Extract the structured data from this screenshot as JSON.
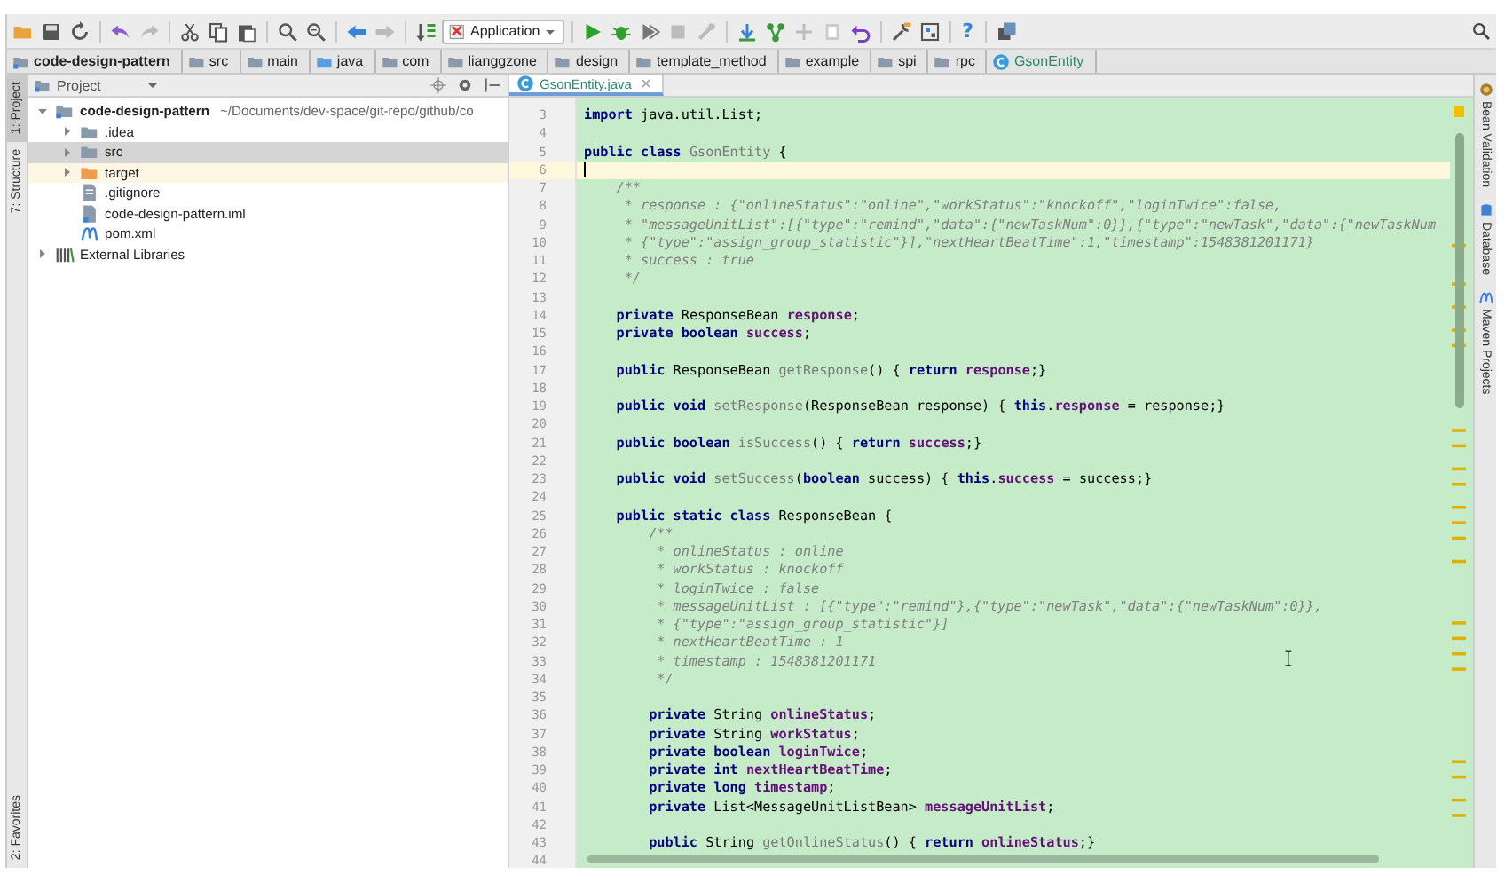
{
  "toolbar": {
    "run_configuration": "Application",
    "help": "?"
  },
  "breadcrumbs": [
    {
      "label": "code-design-pattern",
      "kind": "project"
    },
    {
      "label": "src",
      "kind": "folder"
    },
    {
      "label": "main",
      "kind": "folder"
    },
    {
      "label": "java",
      "kind": "source"
    },
    {
      "label": "com",
      "kind": "folder"
    },
    {
      "label": "lianggzone",
      "kind": "folder"
    },
    {
      "label": "design",
      "kind": "folder"
    },
    {
      "label": "template_method",
      "kind": "folder"
    },
    {
      "label": "example",
      "kind": "folder"
    },
    {
      "label": "spi",
      "kind": "folder"
    },
    {
      "label": "rpc",
      "kind": "folder"
    },
    {
      "label": "GsonEntity",
      "kind": "class"
    }
  ],
  "left_stripe": [
    {
      "label": "1: Project",
      "selected": true
    },
    {
      "label": "7: Structure",
      "selected": false
    }
  ],
  "left_stripe_bottom": [
    {
      "label": "2: Favorites",
      "selected": false
    }
  ],
  "right_stripe": [
    {
      "label": "Bean Validation",
      "kind": "bean"
    },
    {
      "label": "Database",
      "kind": "database"
    },
    {
      "label": "Maven Projects",
      "kind": "maven"
    }
  ],
  "project_panel": {
    "title": "Project",
    "tree": [
      {
        "label": "code-design-pattern",
        "detail": "~/Documents/dev-space/git-repo/github/co",
        "kind": "project",
        "expanded": true,
        "selected": false,
        "highlighted": false,
        "children": [
          {
            "label": ".idea",
            "kind": "folder",
            "expanded": false,
            "selected": false,
            "highlighted": false
          },
          {
            "label": "src",
            "kind": "folder",
            "expanded": false,
            "selected": true,
            "highlighted": false
          },
          {
            "label": "target",
            "kind": "excluded",
            "expanded": false,
            "selected": false,
            "highlighted": true
          },
          {
            "label": ".gitignore",
            "kind": "file",
            "selected": false,
            "highlighted": false
          },
          {
            "label": "code-design-pattern.iml",
            "kind": "module",
            "selected": false,
            "highlighted": false
          },
          {
            "label": "pom.xml",
            "kind": "maven",
            "selected": false,
            "highlighted": false
          }
        ]
      },
      {
        "label": "External Libraries",
        "kind": "library",
        "expanded": false,
        "selected": false,
        "highlighted": false
      }
    ]
  },
  "editor": {
    "tabs": [
      {
        "label": "GsonEntity.java",
        "selected": true
      }
    ],
    "lines": [
      {
        "number": "3",
        "current": false,
        "tokens": [
          {
            "kind": "keyword",
            "text": "import"
          },
          {
            "kind": "plain",
            "text": " java.util.List;"
          }
        ]
      },
      {
        "number": "4",
        "current": false
      },
      {
        "number": "5",
        "current": false,
        "tokens": [
          {
            "kind": "keyword",
            "text": "public class "
          },
          {
            "kind": "unused",
            "text": "GsonEntity"
          },
          {
            "kind": "plain",
            "text": " {"
          }
        ]
      },
      {
        "number": "6",
        "current": true
      },
      {
        "number": "7",
        "current": false,
        "tokens": [
          {
            "kind": "comment",
            "text": "    /**"
          }
        ]
      },
      {
        "number": "8",
        "current": false,
        "tokens": [
          {
            "kind": "comment",
            "text": "     * response : {\"onlineStatus\":\"online\",\"workStatus\":\"knockoff\",\"loginTwice\":false,"
          }
        ]
      },
      {
        "number": "9",
        "current": false,
        "tokens": [
          {
            "kind": "comment",
            "text": "     * \"messageUnitList\":[{\"type\":\"remind\",\"data\":{\"newTaskNum\":0}},{\"type\":\"newTask\",\"data\":{\"newTaskNum"
          }
        ]
      },
      {
        "number": "10",
        "current": false,
        "tokens": [
          {
            "kind": "comment",
            "text": "     * {\"type\":\"assign_group_statistic\"}],\"nextHeartBeatTime\":1,\"timestamp\":1548381201171}"
          }
        ]
      },
      {
        "number": "11",
        "current": false,
        "tokens": [
          {
            "kind": "comment",
            "text": "     * success : true"
          }
        ]
      },
      {
        "number": "12",
        "current": false,
        "tokens": [
          {
            "kind": "comment",
            "text": "     */"
          }
        ]
      },
      {
        "number": "13",
        "current": false
      },
      {
        "number": "14",
        "current": false,
        "tokens": [
          {
            "kind": "keyword",
            "text": "    private"
          },
          {
            "kind": "plain",
            "text": " ResponseBean "
          },
          {
            "kind": "field",
            "text": "response"
          },
          {
            "kind": "plain",
            "text": ";"
          }
        ]
      },
      {
        "number": "15",
        "current": false,
        "tokens": [
          {
            "kind": "keyword",
            "text": "    private boolean "
          },
          {
            "kind": "field",
            "text": "success"
          },
          {
            "kind": "plain",
            "text": ";"
          }
        ]
      },
      {
        "number": "16",
        "current": false
      },
      {
        "number": "17",
        "current": false,
        "tokens": [
          {
            "kind": "keyword",
            "text": "    public"
          },
          {
            "kind": "plain",
            "text": " ResponseBean "
          },
          {
            "kind": "unused",
            "text": "getResponse"
          },
          {
            "kind": "plain",
            "text": "() { "
          },
          {
            "kind": "keyword",
            "text": "return "
          },
          {
            "kind": "field",
            "text": "response"
          },
          {
            "kind": "plain",
            "text": ";}"
          }
        ]
      },
      {
        "number": "18",
        "current": false
      },
      {
        "number": "19",
        "current": false,
        "tokens": [
          {
            "kind": "keyword",
            "text": "    public void "
          },
          {
            "kind": "unused",
            "text": "setResponse"
          },
          {
            "kind": "plain",
            "text": "(ResponseBean response) { "
          },
          {
            "kind": "keyword",
            "text": "this"
          },
          {
            "kind": "plain",
            "text": "."
          },
          {
            "kind": "field",
            "text": "response"
          },
          {
            "kind": "plain",
            "text": " = response;}"
          }
        ]
      },
      {
        "number": "20",
        "current": false
      },
      {
        "number": "21",
        "current": false,
        "tokens": [
          {
            "kind": "keyword",
            "text": "    public boolean "
          },
          {
            "kind": "unused",
            "text": "isSuccess"
          },
          {
            "kind": "plain",
            "text": "() { "
          },
          {
            "kind": "keyword",
            "text": "return "
          },
          {
            "kind": "field",
            "text": "success"
          },
          {
            "kind": "plain",
            "text": ";}"
          }
        ]
      },
      {
        "number": "22",
        "current": false
      },
      {
        "number": "23",
        "current": false,
        "tokens": [
          {
            "kind": "keyword",
            "text": "    public void "
          },
          {
            "kind": "unused",
            "text": "setSuccess"
          },
          {
            "kind": "plain",
            "text": "("
          },
          {
            "kind": "keyword",
            "text": "boolean"
          },
          {
            "kind": "plain",
            "text": " success) { "
          },
          {
            "kind": "keyword",
            "text": "this"
          },
          {
            "kind": "plain",
            "text": "."
          },
          {
            "kind": "field",
            "text": "success"
          },
          {
            "kind": "plain",
            "text": " = success;}"
          }
        ]
      },
      {
        "number": "24",
        "current": false
      },
      {
        "number": "25",
        "current": false,
        "tokens": [
          {
            "kind": "keyword",
            "text": "    public static class"
          },
          {
            "kind": "plain",
            "text": " ResponseBean {"
          }
        ]
      },
      {
        "number": "26",
        "current": false,
        "tokens": [
          {
            "kind": "comment",
            "text": "        /**"
          }
        ]
      },
      {
        "number": "27",
        "current": false,
        "tokens": [
          {
            "kind": "comment",
            "text": "         * onlineStatus : online"
          }
        ]
      },
      {
        "number": "28",
        "current": false,
        "tokens": [
          {
            "kind": "comment",
            "text": "         * workStatus : knockoff"
          }
        ]
      },
      {
        "number": "29",
        "current": false,
        "tokens": [
          {
            "kind": "comment",
            "text": "         * loginTwice : false"
          }
        ]
      },
      {
        "number": "30",
        "current": false,
        "tokens": [
          {
            "kind": "comment",
            "text": "         * messageUnitList : [{\"type\":\"remind\"},{\"type\":\"newTask\",\"data\":{\"newTaskNum\":0}},"
          }
        ]
      },
      {
        "number": "31",
        "current": false,
        "tokens": [
          {
            "kind": "comment",
            "text": "         * {\"type\":\"assign_group_statistic\"}]"
          }
        ]
      },
      {
        "number": "32",
        "current": false,
        "tokens": [
          {
            "kind": "comment",
            "text": "         * nextHeartBeatTime : 1"
          }
        ]
      },
      {
        "number": "33",
        "current": false,
        "tokens": [
          {
            "kind": "comment",
            "text": "         * timestamp : 1548381201171"
          }
        ]
      },
      {
        "number": "34",
        "current": false,
        "tokens": [
          {
            "kind": "comment",
            "text": "         */"
          }
        ]
      },
      {
        "number": "35",
        "current": false
      },
      {
        "number": "36",
        "current": false,
        "tokens": [
          {
            "kind": "keyword",
            "text": "        private"
          },
          {
            "kind": "plain",
            "text": " String "
          },
          {
            "kind": "field",
            "text": "onlineStatus"
          },
          {
            "kind": "plain",
            "text": ";"
          }
        ]
      },
      {
        "number": "37",
        "current": false,
        "tokens": [
          {
            "kind": "keyword",
            "text": "        private"
          },
          {
            "kind": "plain",
            "text": " String "
          },
          {
            "kind": "field",
            "text": "workStatus"
          },
          {
            "kind": "plain",
            "text": ";"
          }
        ]
      },
      {
        "number": "38",
        "current": false,
        "tokens": [
          {
            "kind": "keyword",
            "text": "        private boolean "
          },
          {
            "kind": "field",
            "text": "loginTwice"
          },
          {
            "kind": "plain",
            "text": ";"
          }
        ]
      },
      {
        "number": "39",
        "current": false,
        "tokens": [
          {
            "kind": "keyword",
            "text": "        private int "
          },
          {
            "kind": "field",
            "text": "nextHeartBeatTime"
          },
          {
            "kind": "plain",
            "text": ";"
          }
        ]
      },
      {
        "number": "40",
        "current": false,
        "tokens": [
          {
            "kind": "keyword",
            "text": "        private long "
          },
          {
            "kind": "field",
            "text": "timestamp"
          },
          {
            "kind": "plain",
            "text": ";"
          }
        ]
      },
      {
        "number": "41",
        "current": false,
        "tokens": [
          {
            "kind": "keyword",
            "text": "        private"
          },
          {
            "kind": "plain",
            "text": " List<MessageUnitListBean> "
          },
          {
            "kind": "field",
            "text": "messageUnitList"
          },
          {
            "kind": "plain",
            "text": ";"
          }
        ]
      },
      {
        "number": "42",
        "current": false
      },
      {
        "number": "43",
        "current": false,
        "tokens": [
          {
            "kind": "keyword",
            "text": "        public"
          },
          {
            "kind": "plain",
            "text": " String "
          },
          {
            "kind": "unused",
            "text": "getOnlineStatus"
          },
          {
            "kind": "plain",
            "text": "() { "
          },
          {
            "kind": "keyword",
            "text": "return "
          },
          {
            "kind": "field",
            "text": "onlineStatus"
          },
          {
            "kind": "plain",
            "text": ";}"
          }
        ]
      },
      {
        "number": "44",
        "current": false
      }
    ]
  }
}
